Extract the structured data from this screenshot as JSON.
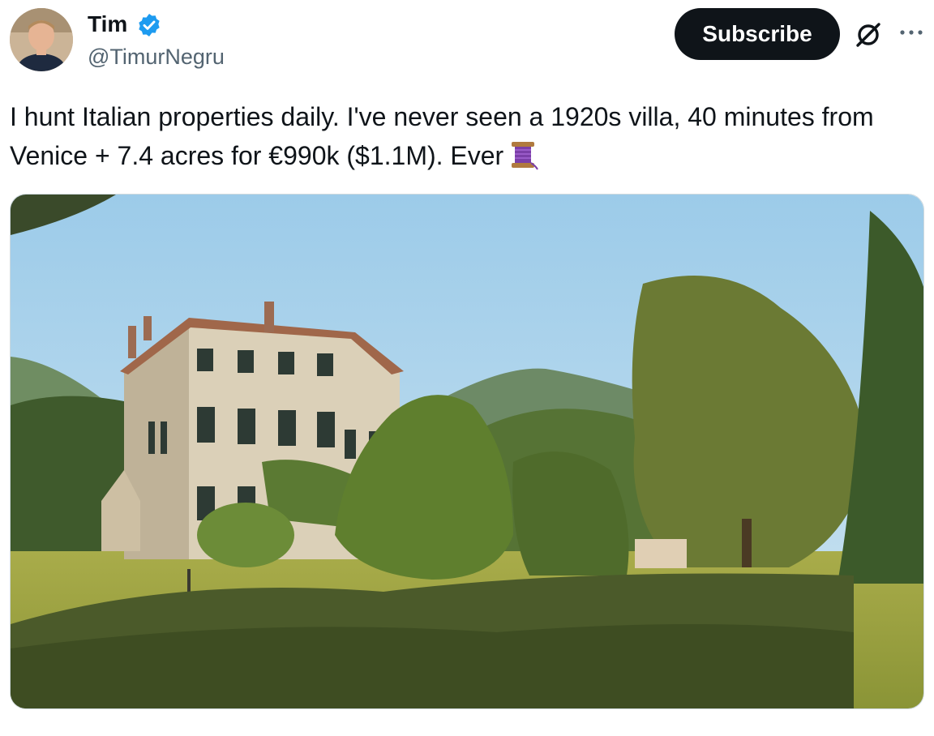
{
  "author": {
    "display_name": "Tim",
    "handle": "@TimurNegru",
    "verified_icon": "verified-badge-icon",
    "avatar_icon": "avatar-photo"
  },
  "actions": {
    "subscribe_label": "Subscribe",
    "grok_icon": "grok-icon",
    "more_icon": "more-options-icon"
  },
  "tweet": {
    "text": "I hunt Italian properties daily. I've never seen a 1920s villa, 40 minutes from Venice + 7.4 acres for €990k ($1.1M). Ever",
    "emoji": "thread-spool-emoji"
  },
  "media": {
    "image_icon": "villa-photo",
    "colors": {
      "sky": "#b3d7ee",
      "lawn": "#9ea43e",
      "hedge": "#4d5a2a",
      "villa": "#d8cdb4",
      "roof": "#a0674a"
    }
  },
  "colors": {
    "accent": "#1d9bf0",
    "text": "#0f1419",
    "secondary": "#536471",
    "button": "#0f1419"
  }
}
